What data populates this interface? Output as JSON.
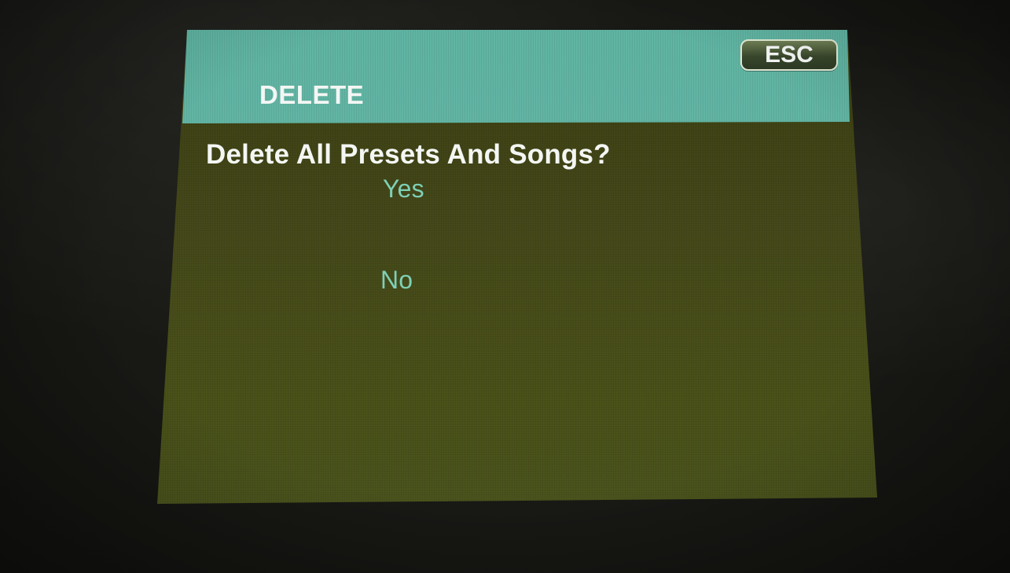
{
  "window": {
    "title": "DELETE"
  },
  "toolbar": {
    "esc_label": "ESC"
  },
  "dialog": {
    "prompt": "Delete All Presets And Songs?",
    "options": [
      {
        "label": "Yes"
      },
      {
        "label": "No"
      }
    ]
  },
  "colors": {
    "header_accent": "#66b7a7",
    "screen_background": "#45491a",
    "prompt_text": "#f3f6f2",
    "option_text": "#7ed0b6"
  }
}
